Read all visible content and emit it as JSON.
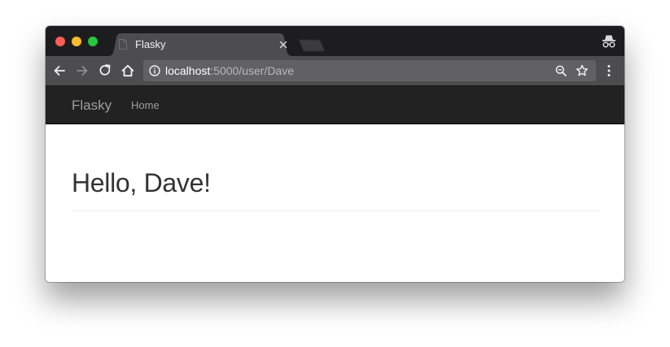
{
  "browser": {
    "tab": {
      "title": "Flasky"
    },
    "address_bar": {
      "host": "localhost",
      "path": ":5000/user/Dave"
    }
  },
  "app": {
    "navbar": {
      "brand": "Flasky",
      "links": [
        {
          "label": "Home"
        }
      ]
    },
    "page_header": {
      "heading": "Hello, Dave!"
    }
  },
  "colors": {
    "tab_strip": "#1d1d1f",
    "toolbar": "#4d4d4f",
    "omnibox": "#616163",
    "navbar": "#222222",
    "navbar_text": "#9d9d9d",
    "heading_text": "#333333"
  },
  "icons": {
    "window_controls": [
      "close-dot",
      "minimize-dot",
      "maximize-dot"
    ],
    "tab_favicon": "document-icon",
    "tab_close": "close-icon",
    "incognito": "incognito-icon",
    "nav": [
      "back-arrow-icon",
      "forward-arrow-icon",
      "reload-icon",
      "home-icon"
    ],
    "omnibox": [
      "info-icon",
      "zoom-icon",
      "star-icon"
    ],
    "menu": "kebab-menu-icon"
  }
}
